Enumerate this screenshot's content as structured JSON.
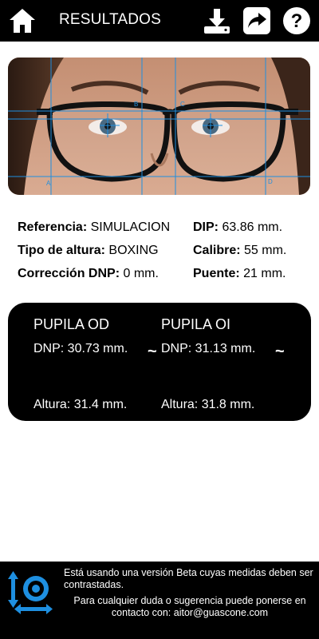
{
  "header": {
    "title": "RESULTADOS"
  },
  "info_left": [
    {
      "label": "Referencia:",
      "value": "SIMULACION"
    },
    {
      "label": "Tipo de altura:",
      "value": "BOXING"
    },
    {
      "label": "Corrección DNP:",
      "value": "0 mm."
    }
  ],
  "info_right": [
    {
      "label": "DIP:",
      "value": "63.86 mm."
    },
    {
      "label": "Calibre:",
      "value": "55 mm."
    },
    {
      "label": "Puente:",
      "value": "21 mm."
    }
  ],
  "photo_labels": {
    "a": "A",
    "b": "B",
    "c": "C",
    "d": "D"
  },
  "card": {
    "od": {
      "title": "PUPILA OD",
      "dnp": "DNP: 30.73 mm.",
      "altura": "Altura: 31.4 mm."
    },
    "oi": {
      "title": "PUPILA OI",
      "dnp": "DNP: 31.13 mm.",
      "altura": "Altura: 31.8 mm."
    },
    "tilde": "~"
  },
  "footer": {
    "beta": "Está usando una versión Beta cuyas medidas deben ser contrastadas.",
    "contact": "Para cualquier duda o sugerencia puede ponerse en contacto con: aitor@guascone.com"
  },
  "colors": {
    "accent": "#1e8fe0",
    "background": "#000000"
  },
  "icons": [
    "home-icon",
    "download-icon",
    "share-icon",
    "help-icon",
    "app-logo-icon"
  ]
}
